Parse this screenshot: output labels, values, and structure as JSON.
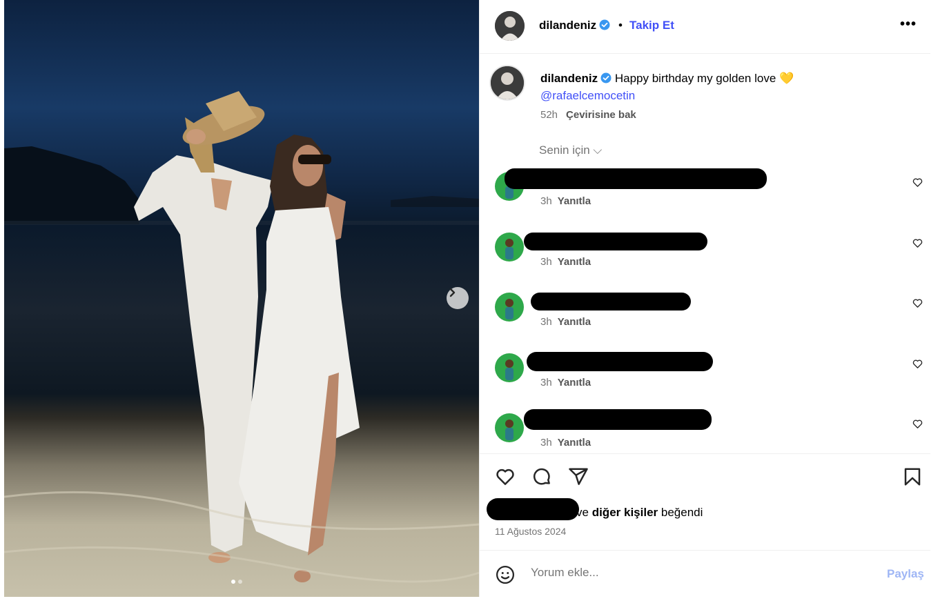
{
  "header": {
    "username": "dilandeniz",
    "separator": "•",
    "follow_label": "Takip Et",
    "more_label": "•••"
  },
  "caption": {
    "username": "dilandeniz",
    "text": "Happy birthday my golden love 💛",
    "mention": "@rafaelcemocetin",
    "time": "52h",
    "translate_label": "Çevirisine bak"
  },
  "comments_filter": "Senin için ⌵",
  "comments": [
    {
      "time": "3h",
      "reply_label": "Yanıtla"
    },
    {
      "time": "3h",
      "reply_label": "Yanıtla"
    },
    {
      "time": "3h",
      "reply_label": "Yanıtla"
    },
    {
      "time": "3h",
      "reply_label": "Yanıtla"
    },
    {
      "time": "3h",
      "reply_label": "Yanıtla"
    }
  ],
  "likes": {
    "suffix_plain": "ve",
    "others_bold": "diğer kişiler",
    "suffix_end": "beğendi"
  },
  "post_date": "11 Ağustos 2024",
  "add_comment": {
    "placeholder": "Yorum ekle...",
    "share_label": "Paylaş"
  },
  "carousel": {
    "slides": 2,
    "active_slide": 1
  },
  "colors": {
    "link": "#4150f7",
    "muted": "#737373",
    "share_disabled": "#9fb6f5",
    "border": "#efefef"
  },
  "icons": [
    "verified-badge-icon",
    "heart-icon",
    "comment-icon",
    "share-icon",
    "bookmark-icon",
    "emoji-icon",
    "chevron-right-icon",
    "more-icon"
  ]
}
